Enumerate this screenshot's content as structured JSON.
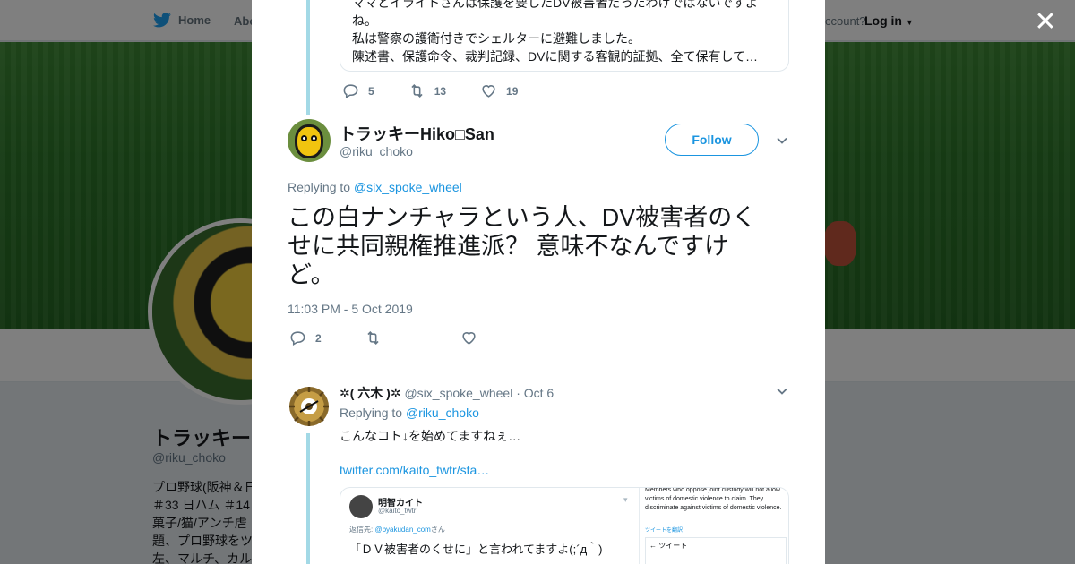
{
  "topbar": {
    "home_label": "Home",
    "about_label": "Abo",
    "account_text": "ccount?",
    "login_label": "Log in"
  },
  "profile": {
    "name": "トラッキー",
    "handle": "@riku_choko",
    "bio": "プロ野球(阪神＆日 ＃33 日ハム ＃14 菓子/猫/アンチ虐 題、プロ野球をツ 左、マルチ、カル"
  },
  "modal": {
    "quoted": {
      "line0": "ママとイライトさんは保護を要したDV被害者だったわけではないですよ",
      "line1": "ね。",
      "line2": "私は警察の護衛付きでシェルターに避難しました。",
      "line3": "陳述書、保護命令、裁判記録、DVに関する客観的証拠、全て保有して…",
      "replies": "5",
      "retweets": "13",
      "likes": "19"
    },
    "tweet": {
      "author_name": "トラッキーHiko□San",
      "author_handle": "@riku_choko",
      "follow_label": "Follow",
      "replying_prefix": "Replying to",
      "replying_to": "@six_spoke_wheel",
      "text": "この白ナンチャラという人、DV被害者のくせに共同親権推進派？ 意味不なんですけど。",
      "timestamp": "11:03 PM - 5 Oct 2019",
      "replies": "2"
    },
    "reply": {
      "author_name": "✲( 六木 )✲",
      "author_handle": "@six_spoke_wheel",
      "date": "· Oct 6",
      "replying_prefix": "Replying to",
      "replying_to": "@riku_choko",
      "text": "こんなコト↓を始めてますねぇ…",
      "link": "twitter.com/kaito_twtr/sta…",
      "media": {
        "name": "明智カイト",
        "handle": "@kaito_twtr",
        "replying": "返信先: ",
        "replying_handle": "@byakudan_com",
        "replying_suffix": "さん",
        "text": "「ＤＶ被害者のくせに」と言われてますよ(;´д｀)",
        "right_text": "Members who oppose joint custody will not allow victims of domestic violence to claim. They discriminate against victims of domestic violence.",
        "right_bar": "ツイートを翻訳",
        "right_tweet": "← ツイート"
      }
    }
  },
  "colors": {
    "link": "#1b95e0",
    "thread_line": "#a3d9e6",
    "muted": "#657786",
    "text": "#14171a"
  },
  "icons": [
    "twitter-bird-icon",
    "close-icon",
    "reply-icon",
    "retweet-icon",
    "like-icon",
    "chevron-down-icon"
  ]
}
